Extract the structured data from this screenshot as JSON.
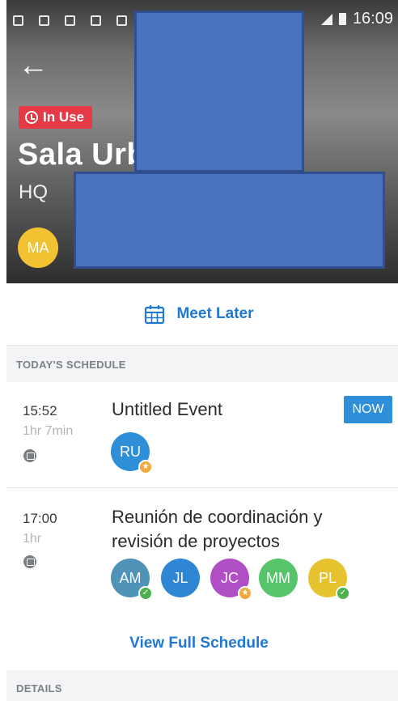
{
  "status_bar": {
    "time": "16:09"
  },
  "room": {
    "status_badge": "In Use",
    "name": "Sala Urb",
    "location": "HQ",
    "occupant_initials": "MA"
  },
  "actions": {
    "meet_later": "Meet Later",
    "view_full_schedule": "View Full Schedule"
  },
  "sections": {
    "todays_schedule": "TODAY'S SCHEDULE",
    "details": "DETAILS"
  },
  "events": [
    {
      "time": "15:52",
      "duration": "1hr 7min",
      "title": "Untitled Event",
      "badge": "NOW",
      "attendees": [
        {
          "initials": "RU",
          "color": "#2e8fd8",
          "marker": "star"
        }
      ]
    },
    {
      "time": "17:00",
      "duration": "1hr",
      "title_line1": "Reunión de coordinación y",
      "title_line2": "revisión de proyectos",
      "attendees": [
        {
          "initials": "AM",
          "color": "#4f94b8",
          "marker": "check"
        },
        {
          "initials": "JL",
          "color": "#2e86d4",
          "marker": ""
        },
        {
          "initials": "JC",
          "color": "#b04fc4",
          "marker": "star"
        },
        {
          "initials": "MM",
          "color": "#56c46a",
          "marker": ""
        },
        {
          "initials": "PL",
          "color": "#e6c22e",
          "marker": "check"
        }
      ]
    }
  ],
  "colors": {
    "accent": "#1f78d1",
    "in_use": "#e53945",
    "now_badge": "#2e8fd8"
  }
}
